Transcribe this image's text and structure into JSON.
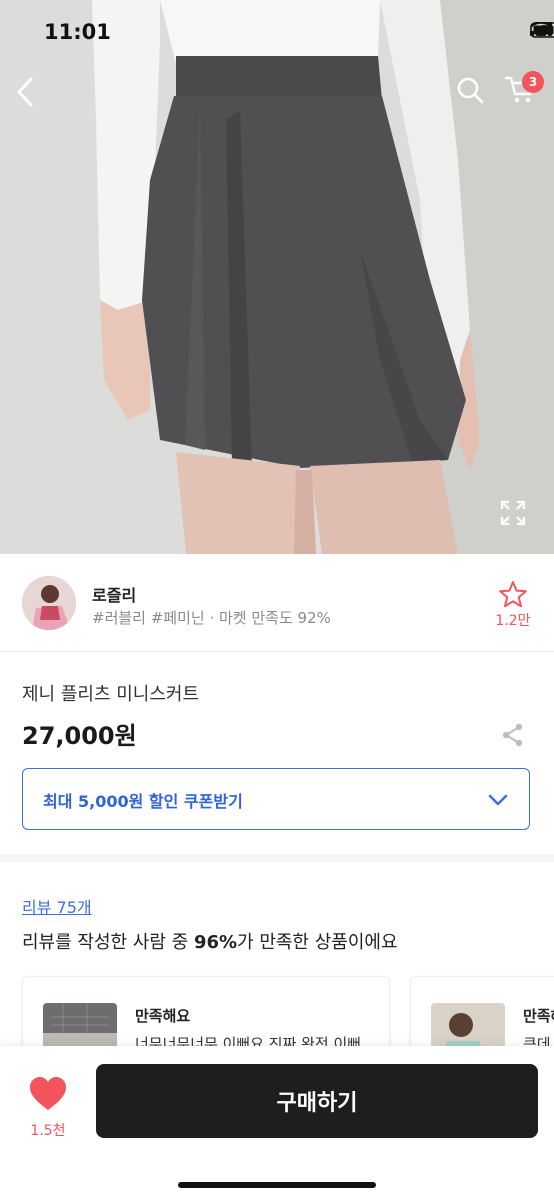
{
  "status_bar": {
    "time": "11:01"
  },
  "header": {
    "cart_count": "3",
    "icons": [
      "back-icon",
      "search-icon",
      "cart-icon",
      "expand-icon"
    ]
  },
  "seller": {
    "name": "로즐리",
    "tags": "#러블리 #페미닌 · 마켓 만족도 92%",
    "favorite_count": "1.2만"
  },
  "product": {
    "name": "제니 플리츠 미니스커트",
    "price": "27,000원"
  },
  "coupon": {
    "label": "최대 5,000원 할인 쿠폰받기"
  },
  "reviews": {
    "link": "리뷰 75개",
    "summary_prefix": "리뷰를 작성한 사람 중 ",
    "summary_percent": "96%",
    "summary_suffix": "가 만족한 상품이에요",
    "cards": [
      {
        "title": "만족해요",
        "body": "너무너무너무 이뻐요 진짜 완전 이뻐"
      },
      {
        "title": "만족해",
        "body": "큰데"
      }
    ]
  },
  "bottom_bar": {
    "like_count": "1.5천",
    "buy_label": "구매하기"
  },
  "colors": {
    "accent_red": "#f2545b",
    "accent_blue": "#3d6fe0",
    "buy_button": "#1e1e1e"
  }
}
